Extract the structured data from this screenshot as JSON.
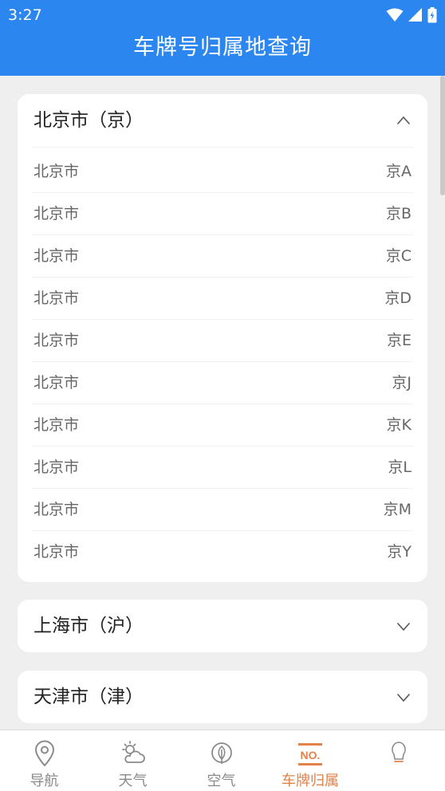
{
  "status": {
    "time": "3:27"
  },
  "app": {
    "title": "车牌号归属地查询"
  },
  "provinces": [
    {
      "title": "北京市（京）",
      "expanded": true,
      "entries": [
        {
          "city": "北京市",
          "code": "京A"
        },
        {
          "city": "北京市",
          "code": "京B"
        },
        {
          "city": "北京市",
          "code": "京C"
        },
        {
          "city": "北京市",
          "code": "京D"
        },
        {
          "city": "北京市",
          "code": "京E"
        },
        {
          "city": "北京市",
          "code": "京J"
        },
        {
          "city": "北京市",
          "code": "京K"
        },
        {
          "city": "北京市",
          "code": "京L"
        },
        {
          "city": "北京市",
          "code": "京M"
        },
        {
          "city": "北京市",
          "code": "京Y"
        }
      ]
    },
    {
      "title": "上海市（沪）",
      "expanded": false
    },
    {
      "title": "天津市（津）",
      "expanded": false
    }
  ],
  "nav": {
    "items": [
      {
        "label": "导航",
        "icon": "location-pin-icon"
      },
      {
        "label": "天气",
        "icon": "weather-icon"
      },
      {
        "label": "空气",
        "icon": "leaf-icon"
      },
      {
        "label": "车牌归属",
        "icon": "license-plate-icon",
        "active": true
      },
      {
        "label": "",
        "icon": "lightbulb-icon"
      }
    ]
  },
  "colors": {
    "primary": "#2b86f0",
    "active_tab": "#e0824a"
  }
}
